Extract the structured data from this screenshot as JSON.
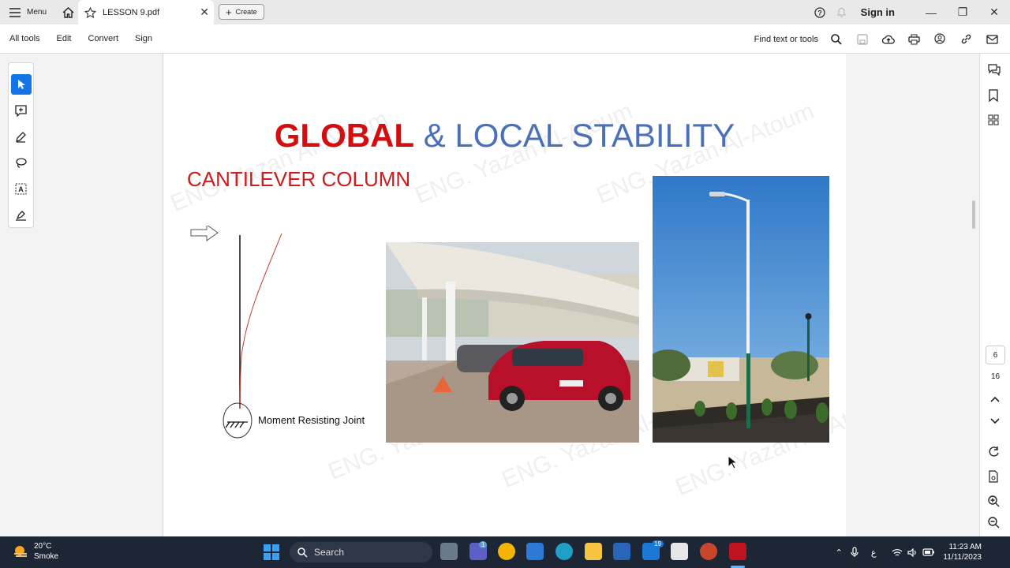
{
  "app": {
    "menu_label": "Menu",
    "tab_title": "LESSON 9.pdf",
    "create_label": "Create",
    "sign_in": "Sign in"
  },
  "toolbar": {
    "all_tools": "All tools",
    "edit": "Edit",
    "convert": "Convert",
    "sign": "Sign",
    "find_label": "Find text or tools"
  },
  "slide": {
    "title_part1": "GLOBAL",
    "title_part2": "& LOCAL STABILITY",
    "subtitle": "CANTILEVER COLUMN",
    "joint_label": "Moment Resisting Joint",
    "watermark": "ENG. Yazan Al-Atoum"
  },
  "pages": {
    "current": "6",
    "total": "16"
  },
  "taskbar": {
    "temperature": "20°C",
    "weather": "Smoke",
    "search_label": "Search",
    "time": "11:23 AM",
    "date": "11/11/2023",
    "badge_teams": "1",
    "badge_mail": "19",
    "tray_lang": "ع"
  },
  "colors": {
    "title_red": "#d40e0e",
    "title_blue": "#4a71b8",
    "accent": "#1473e6",
    "taskbar": "#1c2634"
  }
}
